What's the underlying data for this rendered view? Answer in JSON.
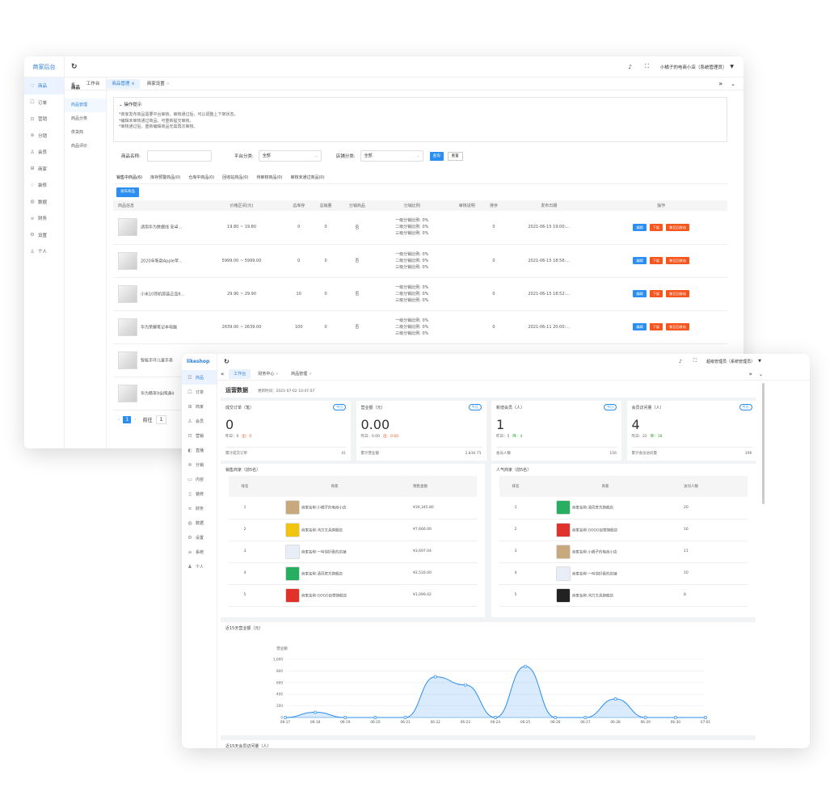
{
  "w1": {
    "brand": "商家后台",
    "nav": [
      {
        "icon": "♡",
        "label": "商品"
      },
      {
        "icon": "☐",
        "label": "订单"
      },
      {
        "icon": "⊡",
        "label": "营销"
      },
      {
        "icon": "⊚",
        "label": "分销"
      },
      {
        "icon": "♙",
        "label": "会员"
      },
      {
        "icon": "⊞",
        "label": "商家"
      },
      {
        "icon": "♢",
        "label": "装修"
      },
      {
        "icon": "◍",
        "label": "数据"
      },
      {
        "icon": "¤",
        "label": "财务"
      },
      {
        "icon": "⚙",
        "label": "设置"
      },
      {
        "icon": "♙",
        "label": "个人"
      }
    ],
    "sub_title": "商品",
    "sub": [
      "商品管理",
      "商品分类",
      "供货商",
      "商品评价"
    ],
    "tabs": [
      "工作台",
      "商品管理",
      "商家设置"
    ],
    "user": "小橘子的电商小店（系统管理员）",
    "tips_title": "操作提示",
    "tips": [
      "*商家发布商品需要平台审核，审核通过后，可以调整上下架状态。",
      "*编辑未审核通过商品，可重新提交审核。",
      "*审核通过后，重新编辑商品无需再次审核。"
    ],
    "filter": {
      "name_label": "商品名称:",
      "platform_label": "平台分类:",
      "platform_value": "全部",
      "shop_label": "店铺分类:",
      "shop_value": "全部",
      "search": "查询",
      "reset": "重置"
    },
    "status_tabs": [
      "销售中商品(6)",
      "库存预警商品(0)",
      "仓库中商品(0)",
      "回收站商品(0)",
      "待审核商品(0)",
      "审核未通过商品(0)"
    ],
    "publish": "发布商品",
    "cols": [
      "商品信息",
      "价格区间(元)",
      "总库存",
      "总销量",
      "分销商品",
      "分销比例",
      "审核说明",
      "排序",
      "发布日期",
      "操作"
    ],
    "ratio": [
      "一级分销比例: 0%",
      "二级分销比例: 0%",
      "三级分销比例: 0%"
    ],
    "actions": [
      "编辑",
      "下架",
      "移至回收站"
    ],
    "rows": [
      {
        "name": "适用华为数据线 安卓...",
        "price": "19.80 ~ 19.80",
        "stock": "0",
        "sales": "0",
        "dist": "否",
        "sort": "0",
        "date": "2021-06-15 19:00:..."
      },
      {
        "name": "2020年新款Apple苹...",
        "price": "5999.00 ~ 5999.00",
        "stock": "0",
        "sales": "0",
        "dist": "否",
        "sort": "0",
        "date": "2021-06-15 18:56:..."
      },
      {
        "name": "小米10耳机原装正品8...",
        "price": "29.90 ~ 29.90",
        "stock": "10",
        "sales": "0",
        "dist": "否",
        "sort": "0",
        "date": "2021-06-15 18:52:..."
      },
      {
        "name": "华为荣耀笔记本电脑",
        "price": "2639.00 ~ 2639.00",
        "stock": "100",
        "sales": "0",
        "dist": "否",
        "sort": "0",
        "date": "2021-06-11 20:00:..."
      },
      {
        "name": "智能手环儿童手表"
      },
      {
        "name": "华为畅享9全网通4"
      }
    ],
    "pager": {
      "page": "1",
      "goto": "前往",
      "num": "1"
    }
  },
  "w2": {
    "brand": "likeshop",
    "nav": [
      {
        "icon": "☷",
        "label": "商品"
      },
      {
        "icon": "☐",
        "label": "订单"
      },
      {
        "icon": "⊞",
        "label": "商家"
      },
      {
        "icon": "♙",
        "label": "会员"
      },
      {
        "icon": "⊡",
        "label": "营销"
      },
      {
        "icon": "◐",
        "label": "直播"
      },
      {
        "icon": "⊚",
        "label": "分销"
      },
      {
        "icon": "▭",
        "label": "内容"
      },
      {
        "icon": "▯",
        "label": "装修"
      },
      {
        "icon": "¤",
        "label": "财务"
      },
      {
        "icon": "◍",
        "label": "数据"
      },
      {
        "icon": "⚙",
        "label": "设置"
      },
      {
        "icon": "≡",
        "label": "系统"
      },
      {
        "icon": "♟",
        "label": "个人"
      }
    ],
    "tabs": [
      "工作台",
      "财务中心",
      "商品管理"
    ],
    "user": "超级管理员（系统管理员）",
    "title": "运营数据",
    "update": "更新时间：2021-07-02 10:47:07",
    "stats": [
      {
        "label": "成交订单（笔）",
        "tag": "今日",
        "value": "0",
        "y_label": "昨日：0",
        "delta": "出：0",
        "delta_color": "#f5561e",
        "total_label": "累计成交订单",
        "total": "41"
      },
      {
        "label": "营业额（元）",
        "tag": "今日",
        "value": "0.00",
        "y_label": "昨日：0.00",
        "delta": "出：0.00",
        "delta_color": "#f5561e",
        "total_label": "累计营业额",
        "total": "2,836.75"
      },
      {
        "label": "新增会员（人）",
        "tag": "今日",
        "value": "1",
        "y_label": "昨日：5",
        "delta": "降：4",
        "delta_color": "#2aa52a",
        "total_label": "会员人数",
        "total": "156"
      },
      {
        "label": "会员访问量（人）",
        "tag": "今日",
        "value": "4",
        "y_label": "昨日：22",
        "delta": "降：18",
        "delta_color": "#2aa52a",
        "total_label": "累计会员访问量",
        "total": "196"
      }
    ],
    "sales_title": "销售商家（前5名）",
    "sales_cols": [
      "排名",
      "商家",
      "销售金额"
    ],
    "sales": [
      [
        "1",
        "商家名称:小橘子的电商小店",
        "¥30,345.80",
        "#c8a97d"
      ],
      [
        "2",
        "商家名称:鸿力文具旗舰店",
        "¥7,666.00",
        "#f1c40f"
      ],
      [
        "3",
        "商家名称:一叫惜好看的店铺",
        "¥3,697.04",
        "#e8eef7"
      ],
      [
        "4",
        "商家名称:清风官方旗舰店",
        "¥2,516.00",
        "#27ae60"
      ],
      [
        "5",
        "商家名称:GOGO自营旗舰店",
        "¥1,099.02",
        "#e0312a"
      ]
    ],
    "pop_title": "人气商家（前5名）",
    "pop_cols": [
      "排名",
      "商家",
      "访问人数"
    ],
    "pop": [
      [
        "1",
        "商家名称:清风官方旗舰店",
        "20",
        "#27ae60"
      ],
      [
        "2",
        "商家名称:GOGO自营旗舰店",
        "16",
        "#e0312a"
      ],
      [
        "3",
        "商家名称:小橘子的电商小店",
        "11",
        "#c8a97d"
      ],
      [
        "4",
        "商家名称:一叫惜好看的店铺",
        "10",
        "#e8eef7"
      ],
      [
        "5",
        "商家名称:鸿力文具旗舰店",
        "8",
        "#222"
      ]
    ],
    "chart_title": "近15天营业额（元）",
    "next_title": "近15天会员访问量（人）"
  },
  "chart_data": {
    "type": "area",
    "title": "近15天营业额（元）",
    "ylabel": "营业额",
    "ylim": [
      0,
      1000
    ],
    "yticks": [
      "1,000",
      "800",
      "600",
      "400",
      "200",
      "0"
    ],
    "categories": [
      "06-17",
      "06-18",
      "06-19",
      "06-20",
      "06-21",
      "06-22",
      "06-23",
      "06-24",
      "06-25",
      "06-26",
      "06-27",
      "06-28",
      "06-29",
      "06-30",
      "07-01"
    ],
    "values": [
      0,
      90,
      0,
      0,
      0,
      700,
      560,
      0,
      880,
      0,
      0,
      320,
      0,
      0,
      0
    ],
    "color": "#2b8ef0"
  }
}
